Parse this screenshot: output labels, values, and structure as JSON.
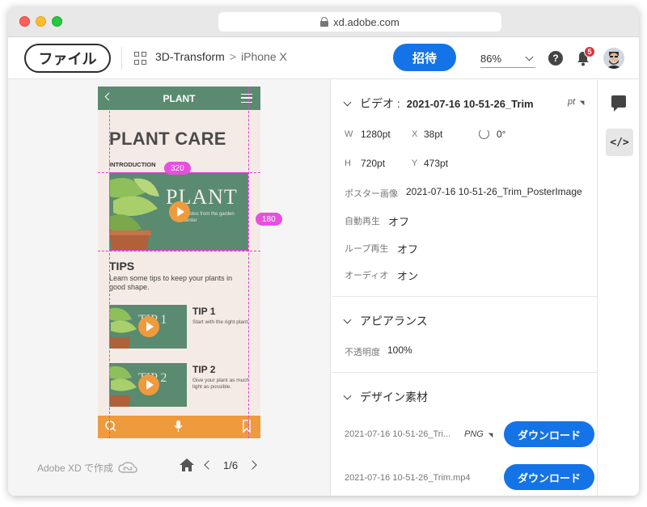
{
  "browser": {
    "url": "xd.adobe.com"
  },
  "toolbar": {
    "file_label": "ファイル",
    "breadcrumb": [
      "3D-Transform",
      "iPhone X"
    ],
    "invite_label": "招待",
    "zoom": "86%",
    "help_label": "?",
    "notification_count": "5"
  },
  "artboard": {
    "header_title": "PLANT",
    "title": "PLANT CARE",
    "intro_label": "INTRODUCTION",
    "hero_text": "PLANT",
    "hero_subtext": "Photos from the garden center",
    "tips_heading": "TIPS",
    "tips_text": "Learn some tips to keep your plants in good shape.",
    "tips": [
      {
        "thumb_text": "TIP 1",
        "title": "TIP 1",
        "desc": "Start with the right plant."
      },
      {
        "thumb_text": "TIP 2",
        "title": "TIP 2",
        "desc": "Give your plant as much light as possible."
      }
    ],
    "measure_width": "320",
    "measure_height": "180"
  },
  "canvas": {
    "credit": "Adobe XD で作成",
    "page_indicator": "1/6"
  },
  "panel": {
    "video": {
      "section_label": "ビデオ :",
      "name": "2021-07-16 10-51-26_Trim",
      "unit": "pt",
      "w_label": "W",
      "w_value": "1280pt",
      "x_label": "X",
      "x_value": "38pt",
      "rotation": "0°",
      "h_label": "H",
      "h_value": "720pt",
      "y_label": "Y",
      "y_value": "473pt",
      "poster_label": "ポスター画像",
      "poster_value": "2021-07-16 10-51-26_Trim_PosterImage",
      "autoplay_label": "自動再生",
      "autoplay_value": "オフ",
      "loop_label": "ループ再生",
      "loop_value": "オフ",
      "audio_label": "オーディオ",
      "audio_value": "オン"
    },
    "appearance": {
      "section_label": "アピアランス",
      "opacity_label": "不透明度",
      "opacity_value": "100%"
    },
    "assets": {
      "section_label": "デザイン素材",
      "items": [
        {
          "name": "2021-07-16 10-51-26_Tri...",
          "format": "PNG",
          "button": "ダウンロード"
        },
        {
          "name": "2021-07-16 10-51-26_Trim.mp4",
          "button": "ダウンロード"
        }
      ]
    }
  },
  "rail": {
    "code_label": "</>"
  },
  "colors": {
    "accent": "#1473e6",
    "plant_green": "#5a8a6f",
    "plant_orange": "#f09a3e",
    "guide_magenta": "#e040d8",
    "badge_red": "#d7373f"
  }
}
